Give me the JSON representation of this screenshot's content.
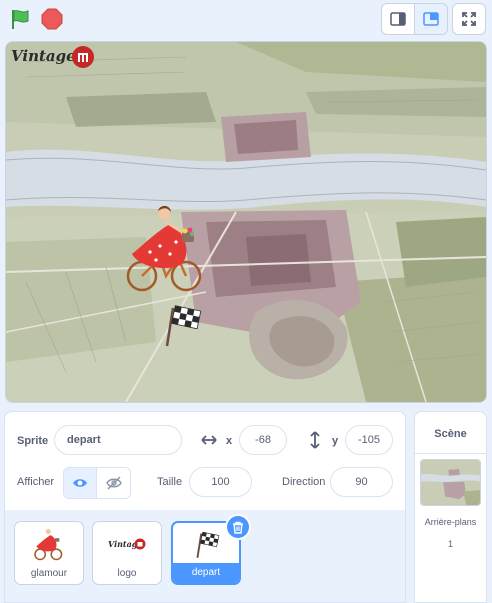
{
  "toolbar": {
    "flag_icon": "green-flag-icon",
    "stop_icon": "stop-sign-icon",
    "small_stage_icon": "small-stage-icon",
    "normal_stage_icon": "normal-stage-icon",
    "fullscreen_icon": "fullscreen-icon"
  },
  "stage": {
    "logo_text": "Vintage"
  },
  "sprite_info": {
    "sprite_label": "Sprite",
    "sprite_name": "depart",
    "x_label": "x",
    "x_value": "-68",
    "y_label": "y",
    "y_value": "-105",
    "show_label": "Afficher",
    "size_label": "Taille",
    "size_value": "100",
    "direction_label": "Direction",
    "direction_value": "90"
  },
  "sprites": [
    {
      "name": "glamour",
      "icon": "cyclist-icon"
    },
    {
      "name": "logo",
      "icon": "logo-icon"
    },
    {
      "name": "depart",
      "icon": "checkered-flag-icon",
      "selected": true
    }
  ],
  "scene": {
    "title": "Scène",
    "backdrops_label": "Arrière-plans",
    "backdrops_count": "1"
  },
  "colors": {
    "accent": "#4c97ff",
    "flag_green": "#4cbf56",
    "stop_red": "#ec5959"
  }
}
